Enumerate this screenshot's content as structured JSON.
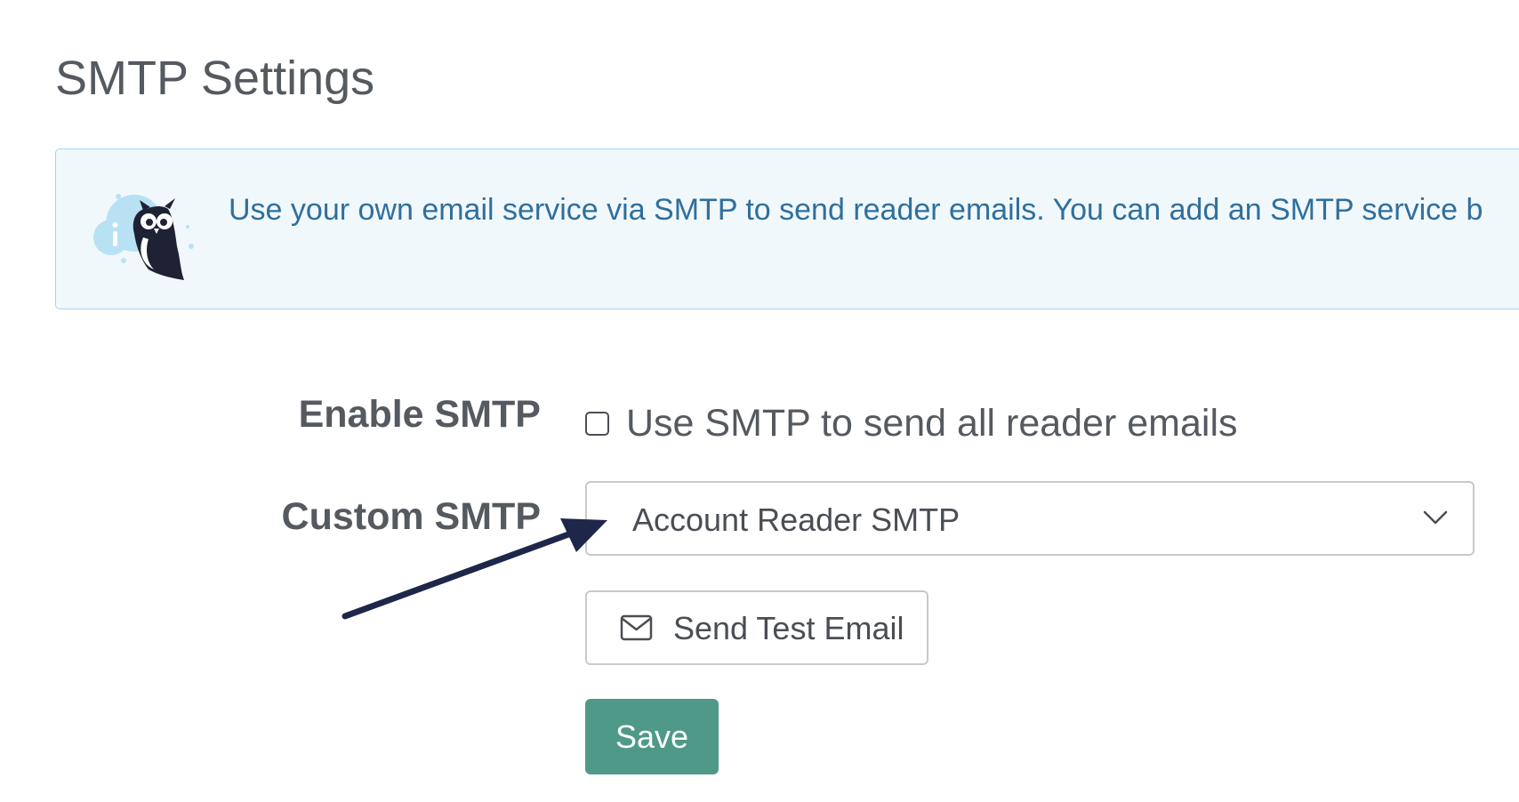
{
  "page": {
    "title": "SMTP Settings"
  },
  "info_box": {
    "icon": "owl-info-icon",
    "text": "Use your own email service via SMTP to send reader emails. You can add an SMTP service b"
  },
  "form": {
    "enable_smtp": {
      "label": "Enable SMTP",
      "checkbox_label": "Use SMTP to send all reader emails",
      "checked": false
    },
    "custom_smtp": {
      "label": "Custom SMTP",
      "selected_value": "Account Reader SMTP",
      "icon": "chevron-down-icon"
    },
    "test_button": {
      "label": "Send Test Email",
      "icon": "envelope-icon"
    },
    "save_button": {
      "label": "Save"
    }
  },
  "colors": {
    "title_text": "#555a60",
    "info_background": "#f1f8fb",
    "info_border": "#a9d4ea",
    "info_text": "#2f6f9e",
    "save_button": "#4e9988",
    "annotation_arrow": "#1e2749"
  }
}
